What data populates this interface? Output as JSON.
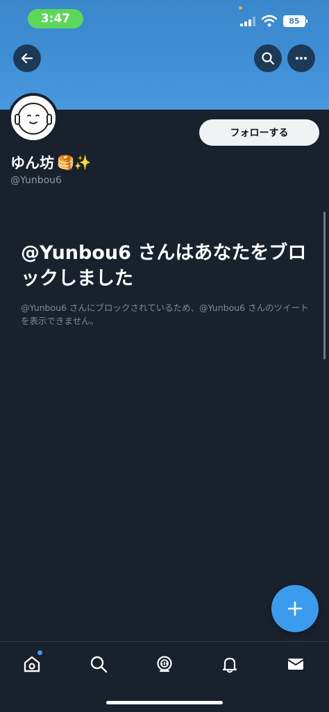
{
  "status_bar": {
    "time": "3:47",
    "battery": "85"
  },
  "profile": {
    "display_name": "ゆん坊",
    "name_emojis": "🥞✨",
    "handle": "@Yunbou6",
    "follow_label": "フォローする"
  },
  "blocked": {
    "title": "@Yunbou6 さんはあなたをブロックしました",
    "description": "@Yunbou6 さんにブロックされているため、@Yunbou6 さんのツイートを表示できません。"
  },
  "icons": {
    "back": "back-arrow-icon",
    "search": "search-icon",
    "more": "more-icon",
    "compose": "plus-icon",
    "tabs": [
      "home-icon",
      "search-icon",
      "spaces-icon",
      "bell-icon",
      "mail-icon"
    ]
  },
  "colors": {
    "background": "#19212c",
    "banner": "#3f8fd6",
    "accent": "#3b9ced",
    "time_pill": "#5bd75a",
    "muted_text": "#7d8a96"
  },
  "tab_bar": {
    "active": "home",
    "home_badge": true
  }
}
